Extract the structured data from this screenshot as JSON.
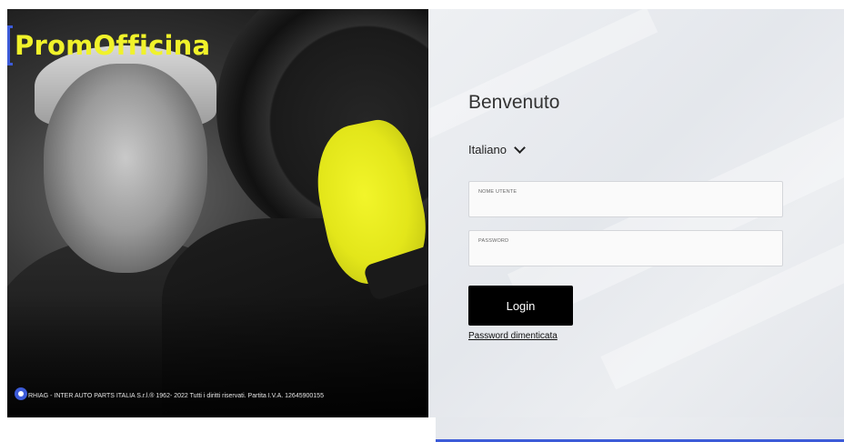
{
  "brand": {
    "logo_text": "PromOfficina",
    "logo_color": "#f0f22a",
    "bracket_color": "#3c5bd8"
  },
  "footer": {
    "icon": "cookie-settings-icon",
    "text": "RHIAG - INTER AUTO PARTS ITALIA S.r.l.® 1962- 2022 Tutti i diritti riservati. Partita I.V.A. 12645900155"
  },
  "login": {
    "title": "Benvenuto",
    "language_selected": "Italiano",
    "language_icon": "chevron-down-icon",
    "username_label": "NOME UTENTE",
    "username_value": "",
    "password_label": "PASSWORD",
    "password_value": "",
    "login_button": "Login",
    "forgot_link": "Password dimenticata"
  },
  "colors": {
    "button_bg": "#000000",
    "panel_bg": "#eceef1"
  }
}
